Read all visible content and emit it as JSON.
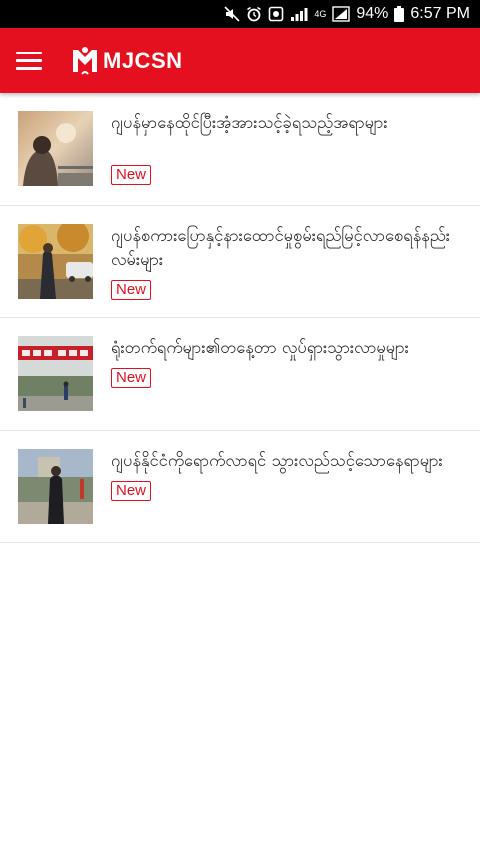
{
  "status_bar": {
    "battery": "94%",
    "time": "6:57 PM",
    "network": "4G"
  },
  "app_bar": {
    "title": "MJCSN",
    "accent_color": "#e5101f",
    "menu_icon": "hamburger-menu-icon"
  },
  "articles": [
    {
      "title": "ဂျပန်မှာနေထိုင်ပြီးအံ့အားသင့်ခဲ့ရသည့်အရာများ",
      "badge": "New"
    },
    {
      "title": "ဂျပန်စကားပြောနှင့်နားထောင်မှုစွမ်းရည်မြင့်လာစေရန်နည်းလမ်းများ",
      "badge": "New"
    },
    {
      "title": "ရုံးတက်ရက်များ၏တနေ့တာ လှုပ်ရှားသွားလာမှုများ",
      "badge": "New"
    },
    {
      "title": "ဂျပန်နိုင်ငံကိုရောက်လာရင် သွားလည်သင့်သောနေရာများ",
      "badge": "New"
    }
  ]
}
